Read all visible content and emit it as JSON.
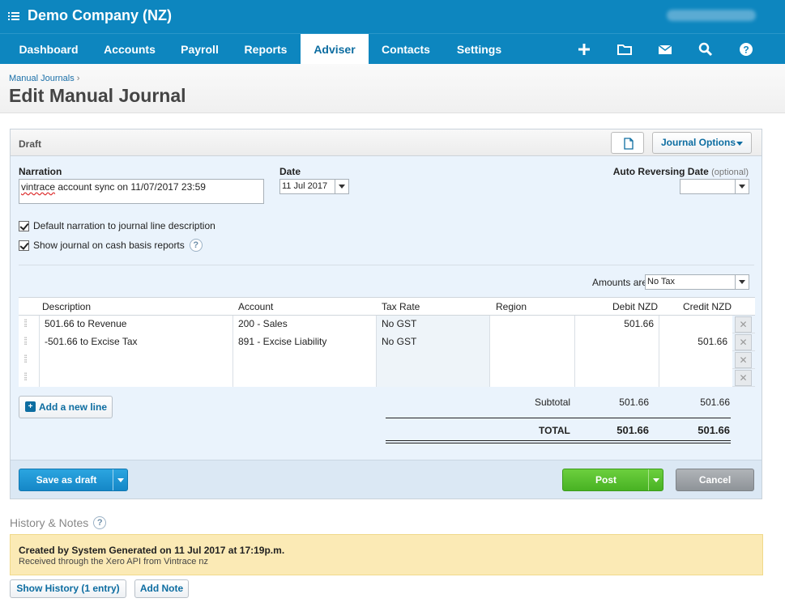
{
  "header": {
    "org_name": "Demo Company (NZ)",
    "nav": [
      "Dashboard",
      "Accounts",
      "Payroll",
      "Reports",
      "Adviser",
      "Contacts",
      "Settings"
    ],
    "active_nav": "Adviser",
    "icons": [
      "plus-icon",
      "folder-icon",
      "mail-icon",
      "search-icon",
      "help-icon"
    ]
  },
  "page": {
    "breadcrumb": "Manual Journals",
    "breadcrumb_sep": "›",
    "title": "Edit Manual Journal"
  },
  "journal": {
    "status": "Draft",
    "options_label": "Journal Options",
    "narration_label": "Narration",
    "narration_value_sq": "vintrace",
    "narration_value_rest": " account sync on 11/07/2017 23:59",
    "date_label": "Date",
    "date_value": "11 Jul 2017",
    "auto_rev_label": "Auto Reversing Date",
    "auto_rev_optional": "(optional)",
    "auto_rev_value": "",
    "chk_default_narration": "Default narration to journal line description",
    "chk_cash_basis": "Show journal on cash basis reports",
    "amounts_are_label": "Amounts are",
    "amounts_are_value": "No Tax",
    "columns": {
      "description": "Description",
      "account": "Account",
      "tax_rate": "Tax Rate",
      "region": "Region",
      "debit": "Debit NZD",
      "credit": "Credit NZD"
    },
    "rows": [
      {
        "description": "501.66 to Revenue",
        "account": "200 - Sales",
        "tax_rate": "No GST",
        "region": "",
        "debit": "501.66",
        "credit": ""
      },
      {
        "description": "-501.66 to Excise Tax",
        "account": "891 - Excise Liability",
        "tax_rate": "No GST",
        "region": "",
        "debit": "",
        "credit": "501.66"
      },
      {
        "description": "",
        "account": "",
        "tax_rate": "",
        "region": "",
        "debit": "",
        "credit": ""
      },
      {
        "description": "",
        "account": "",
        "tax_rate": "",
        "region": "",
        "debit": "",
        "credit": ""
      }
    ],
    "add_line": "Add a new line",
    "subtotal_label": "Subtotal",
    "subtotal_debit": "501.66",
    "subtotal_credit": "501.66",
    "total_label": "TOTAL",
    "total_debit": "501.66",
    "total_credit": "501.66",
    "save_draft": "Save as draft",
    "post": "Post",
    "cancel": "Cancel"
  },
  "history": {
    "title": "History & Notes",
    "entry_title": "Created by System Generated on 11 Jul 2017 at 17:19p.m.",
    "entry_detail": "Received through the Xero API from Vintrace nz",
    "show_history": "Show History (1 entry)",
    "add_note": "Add Note"
  },
  "colors": {
    "brand": "#0d86bf",
    "post": "#48b223",
    "save": "#1587c7",
    "note_bg": "#fbeab5"
  }
}
